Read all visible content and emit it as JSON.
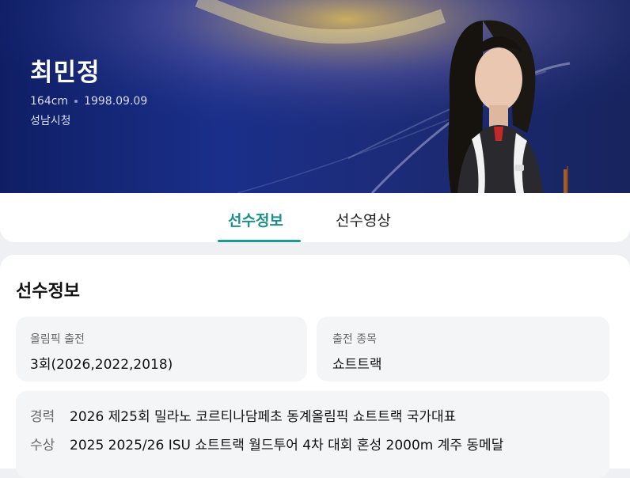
{
  "athlete": {
    "name": "최민정",
    "height": "164cm",
    "birthdate": "1998.09.09",
    "team": "성남시청"
  },
  "tabs": [
    {
      "label": "선수정보",
      "active": true
    },
    {
      "label": "선수영상",
      "active": false
    }
  ],
  "info": {
    "section_title": "선수정보",
    "olympics_label": "올림픽 출전",
    "olympics_value": "3회(2026,2022,2018)",
    "event_label": "출전 종목",
    "event_value": "쇼트트랙",
    "career_label": "경력",
    "career_value": "2026 제25회 밀라노 코르티나담페초 동계올림픽 쇼트트랙 국가대표",
    "award_label": "수상",
    "award_value": "2025 2025/26 ISU 쇼트트랙 월드투어 4차 대회 혼성 2000m 계주 동메달"
  },
  "colors": {
    "hero_bg": "#1a2f8a",
    "accent": "#1d9a94"
  }
}
